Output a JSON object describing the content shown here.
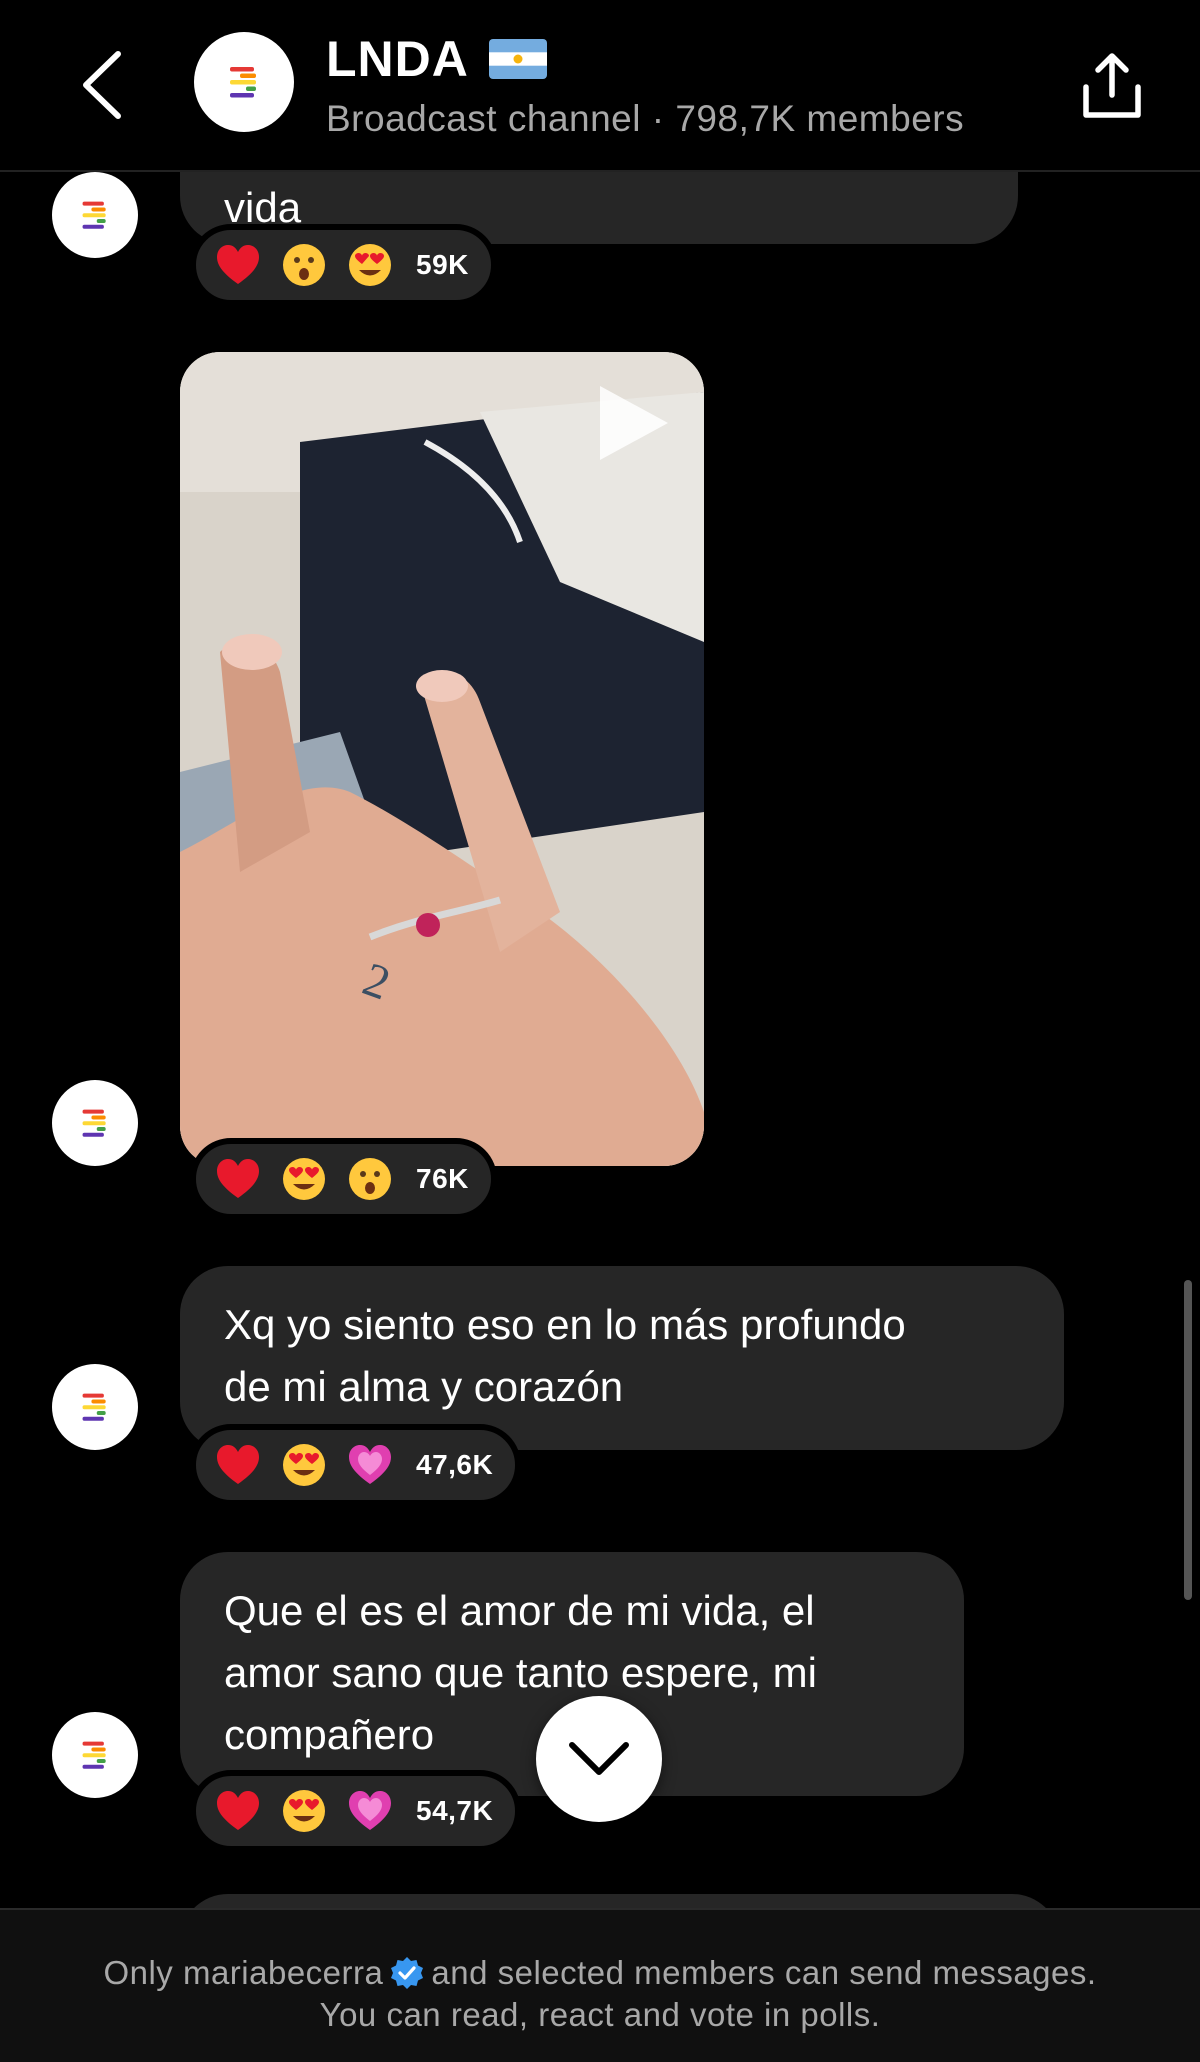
{
  "header": {
    "channel_name": "LNDA",
    "subtitle": "Broadcast channel · 798,7K members",
    "back_icon": "chevron-left-icon",
    "share_icon": "share-icon"
  },
  "messages": [
    {
      "type": "text",
      "text": "vida",
      "reactions": {
        "emojis": [
          "red-heart",
          "astonished-face",
          "heart-eyes-face"
        ],
        "count": "59K"
      }
    },
    {
      "type": "video",
      "icon": "play-icon",
      "reactions": {
        "emojis": [
          "red-heart",
          "heart-eyes-face",
          "astonished-face"
        ],
        "count": "76K"
      }
    },
    {
      "type": "text",
      "lines": [
        "Xq yo siento eso en lo más profundo",
        "de mi alma y corazón"
      ],
      "reactions": {
        "emojis": [
          "red-heart",
          "heart-eyes-face",
          "growing-heart"
        ],
        "count": "47,6K"
      }
    },
    {
      "type": "text",
      "lines": [
        "Que el es el amor de mi vida, el",
        "amor sano que tanto espere, mi",
        "compañero"
      ],
      "reactions": {
        "emojis": [
          "red-heart",
          "heart-eyes-face",
          "growing-heart"
        ],
        "count": "54,7K"
      }
    }
  ],
  "footer": {
    "line1_before": "Only mariabecerra",
    "line1_after": "and selected members can send messages.",
    "line2": "You can read, react and vote in polls."
  },
  "colors": {
    "background": "#000000",
    "bubble": "#262626",
    "secondary_text": "#a8a8a8",
    "verified_blue": "#3897f0"
  }
}
